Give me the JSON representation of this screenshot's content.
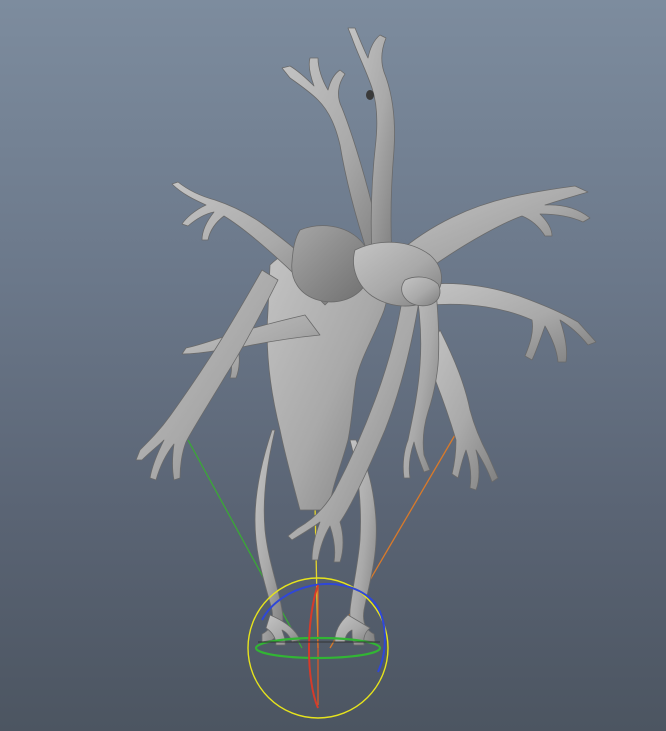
{
  "viewport": {
    "background_top": "#7d8c9e",
    "background_bottom": "#4c5561"
  },
  "model": {
    "icon": "creature-sculpt-model",
    "skin_color": "#a9a9a9",
    "shadow_color": "#7e7e7e",
    "highlight_color": "#c4c4c4"
  },
  "manipulator": {
    "icon": "rotate-manipulator",
    "ring_outer_color": "#e6e31d",
    "x_axis_color": "#d63b2a",
    "y_axis_color": "#32b534",
    "z_axis_color": "#2f47d8",
    "guide_colors": [
      "#3aa836",
      "#e6d62c",
      "#d97a2a",
      "#d45a2a"
    ]
  }
}
